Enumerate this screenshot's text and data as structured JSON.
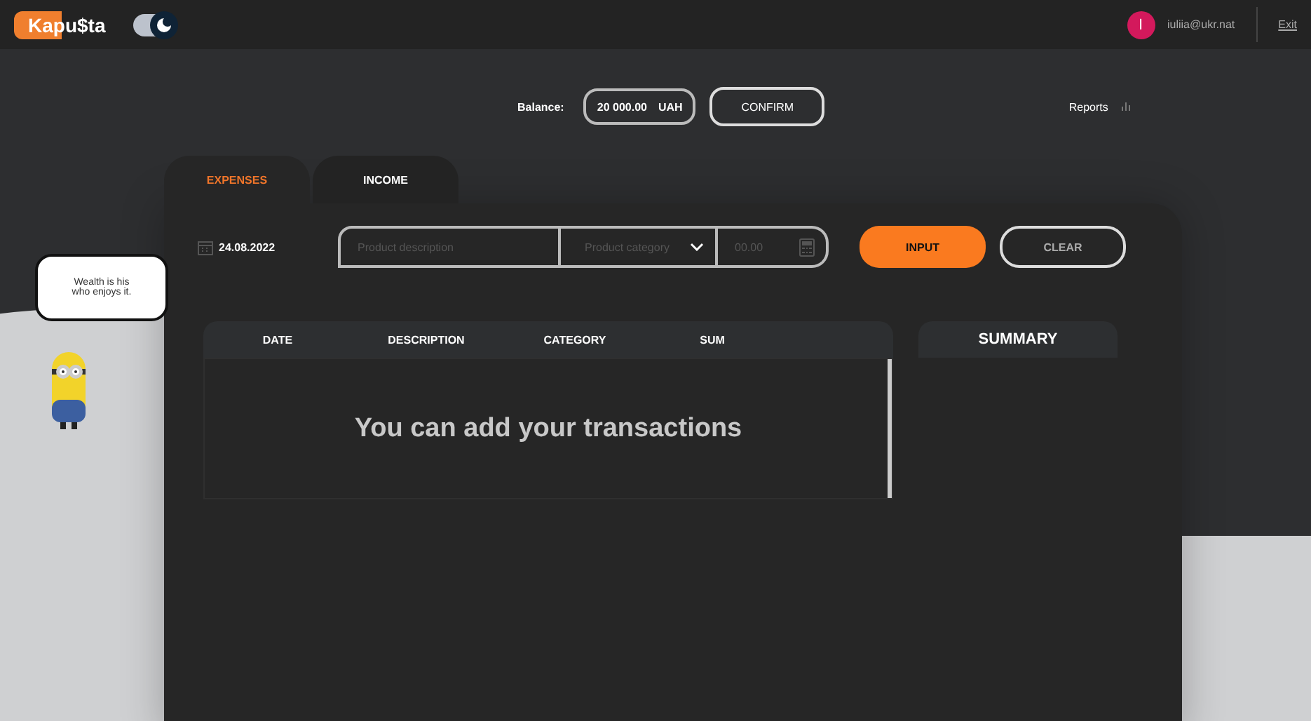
{
  "header": {
    "logo": "Kapu$ta",
    "theme_toggle": {
      "on": true
    },
    "user": {
      "initial": "I",
      "email": "iuliia@ukr.nat"
    },
    "exit": "Exit"
  },
  "balance": {
    "label": "Balance:",
    "amount": "20 000.00",
    "currency": "UAH",
    "confirm": "CONFIRM"
  },
  "reports": "Reports",
  "tabs": [
    {
      "label": "EXPENSES",
      "selected": true
    },
    {
      "label": "INCOME",
      "selected": false
    }
  ],
  "form": {
    "date": "24.08.2022",
    "description": {
      "placeholder": "Product description"
    },
    "category": {
      "placeholder": "Product category"
    },
    "amount": {
      "placeholder": "00.00"
    },
    "buttons": [
      {
        "label": "INPUT",
        "kind": "primary"
      },
      {
        "label": "CLEAR",
        "kind": "secondary"
      }
    ]
  },
  "table": {
    "columns": [
      "DATE",
      "DESCRIPTION",
      "CATEGORY",
      "SUM"
    ],
    "empty_message": "You can add your transactions"
  },
  "summary": {
    "title": "SUMMARY"
  },
  "speech_bubble": "Wealth is his\nwho enjoys it."
}
